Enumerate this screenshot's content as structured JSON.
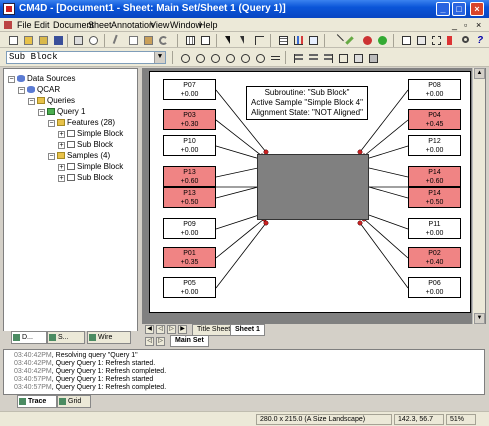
{
  "window": {
    "title": "CM4D - [Document1 - Sheet: Main Set/Sheet 1 (Query 1)]"
  },
  "menu": [
    "File",
    "Edit",
    "Document",
    "Sheet",
    "Annotation",
    "View",
    "Window",
    "Help"
  ],
  "toolbar": {
    "subroutine_combo_value": "Sub Block"
  },
  "tree": {
    "root": "Data Sources",
    "source": "QCAR",
    "queries_label": "Queries",
    "query": "Query 1",
    "features_label": "Features (28)",
    "features": [
      "Simple Block",
      "Sub Block"
    ],
    "samples_label": "Samples (4)",
    "samples": [
      "Simple Block",
      "Sub Block"
    ]
  },
  "left_tabs": [
    "D...",
    "S...",
    "Wire"
  ],
  "sheet": {
    "info_lines": [
      "Subroutine: \"Sub Block\"",
      "Active Sample \"Simple Block 4\"",
      "Alignment State: \"NOT Aligned\""
    ],
    "left_boxes": [
      {
        "name": "P07",
        "value": "+0.00",
        "alert": false
      },
      {
        "name": "P03",
        "value": "+0.30",
        "alert": true
      },
      {
        "name": "P10",
        "value": "+0.00",
        "alert": false
      },
      {
        "name": "P13",
        "value": "+0.60",
        "alert": true
      },
      {
        "name": "P13",
        "value": "+0.50",
        "alert": true
      },
      {
        "name": "P09",
        "value": "+0.00",
        "alert": false
      },
      {
        "name": "P01",
        "value": "+0.35",
        "alert": true
      },
      {
        "name": "P05",
        "value": "+0.00",
        "alert": false
      }
    ],
    "right_boxes": [
      {
        "name": "P08",
        "value": "+0.00",
        "alert": false
      },
      {
        "name": "P04",
        "value": "+0.45",
        "alert": true
      },
      {
        "name": "P12",
        "value": "+0.00",
        "alert": false
      },
      {
        "name": "P14",
        "value": "+0.60",
        "alert": true
      },
      {
        "name": "P14",
        "value": "+0.50",
        "alert": true
      },
      {
        "name": "P11",
        "value": "+0.00",
        "alert": false
      },
      {
        "name": "P02",
        "value": "+0.40",
        "alert": true
      },
      {
        "name": "P06",
        "value": "+0.00",
        "alert": false
      }
    ],
    "colors": {
      "alert": "#f08484",
      "normal": "#ffffff",
      "part": "#808080"
    }
  },
  "sheet_tabs": [
    "Title Sheet",
    "Sheet 1"
  ],
  "set_tabs": [
    "Main Set"
  ],
  "trace_log": [
    {
      "time": "03:40:42PM",
      "text": "Resolving query \"Query 1\""
    },
    {
      "time": "03:40:42PM",
      "text": "Query Query 1: Refresh started."
    },
    {
      "time": "03:40:42PM",
      "text": "Query Query 1: Refresh completed."
    },
    {
      "time": "03:40:57PM",
      "text": "Query Query 1: Refresh started"
    },
    {
      "time": "03:40:57PM",
      "text": "Query Query 1: Refresh completed."
    }
  ],
  "bottom_tabs": [
    "Trace",
    "Grid"
  ],
  "status": {
    "page_size": "280.0 x 215.0 (A Size Landscape)",
    "coords": "142.3,   56.7",
    "zoom": "51%"
  }
}
